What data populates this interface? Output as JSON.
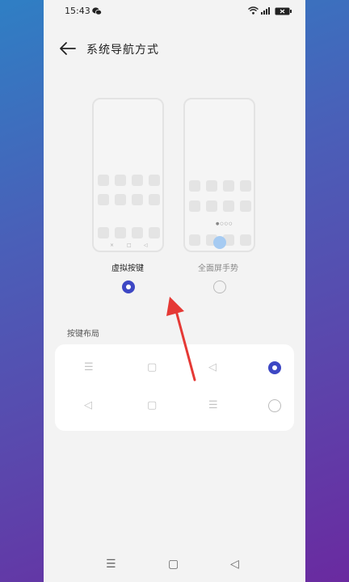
{
  "status_bar": {
    "time": "15:43"
  },
  "header": {
    "title": "系统导航方式"
  },
  "nav_options": [
    {
      "label": "虚拟按键",
      "selected": true
    },
    {
      "label": "全面屏手势",
      "selected": false
    }
  ],
  "mock_keybar": [
    "×",
    "□",
    "◁"
  ],
  "key_layout": {
    "section_label": "按键布局",
    "rows": [
      {
        "keys": [
          "☰",
          "▢",
          "◁"
        ],
        "selected": true
      },
      {
        "keys": [
          "◁",
          "▢",
          "☰"
        ],
        "selected": false
      }
    ]
  },
  "bottom_nav": [
    "☰",
    "▢",
    "◁"
  ],
  "colors": {
    "accent": "#3d47c4",
    "annotation_arrow": "#e53935"
  }
}
